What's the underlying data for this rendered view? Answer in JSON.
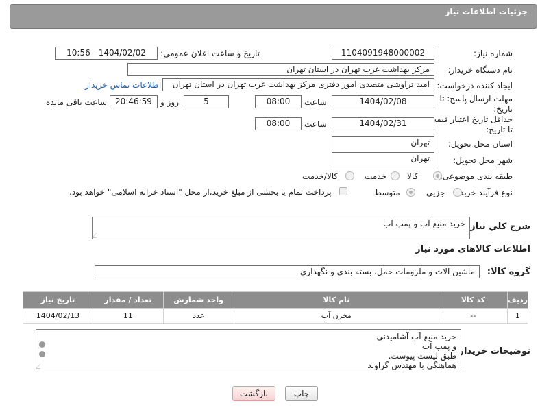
{
  "header": {
    "title": "جزئیات اطلاعات نیاز"
  },
  "fields": {
    "need_number_label": "شماره نیاز:",
    "need_number": "1104091948000002",
    "announce_label": "تاریخ و ساعت اعلان عمومی:",
    "announce_value": "1404/02/02 - 10:56",
    "buyer_org_label": "نام دستگاه خریدار:",
    "buyer_org": "مرکز بهداشت غرب تهران در استان تهران",
    "creator_label": "ایجاد کننده درخواست:",
    "creator": "امید تراوشی متصدی امور دفتری مرکز بهداشت غرب تهران در استان تهران",
    "contact_link": "اطلاعات تماس خریدار",
    "deadline_label": "مهلت ارسال پاسخ: تا تاریخ:",
    "deadline_date": "1404/02/08",
    "time_label": "ساعت",
    "deadline_time": "08:00",
    "days_value": "5",
    "days_label": "روز و",
    "remaining_time": "20:46:59",
    "remaining_label": "ساعت باقی مانده",
    "price_validity_label": "حداقل تاریخ اعتبار قیمت: تا تاریخ:",
    "price_validity_date": "1404/02/31",
    "price_validity_time": "08:00",
    "province_label": "استان محل تحویل:",
    "province": "تهران",
    "city_label": "شهر محل تحویل:",
    "city": "تهران",
    "category_label": "طبقه بندی موضوعی:",
    "category_options": [
      "کالا",
      "خدمت",
      "کالا/خدمت"
    ],
    "purchase_type_label": "نوع فرآیند خرید :",
    "purchase_options": [
      "جزیی",
      "متوسط"
    ],
    "payment_note": "پرداخت تمام یا بخشی از مبلغ خرید،از محل \"اسناد خزانه اسلامی\" خواهد بود."
  },
  "summary": {
    "label": "شرح کلي نياز:",
    "value": "خرید منبع آب و پمپ آب"
  },
  "goods": {
    "section_title": "اطلاعات کالاهای مورد نیاز",
    "group_label": "گروه کالا:",
    "group_value": "ماشین آلات و ملزومات حمل، بسته بندی و نگهداری",
    "columns": [
      "ردیف",
      "کد کالا",
      "نام کالا",
      "واحد شمارش",
      "تعداد / مقدار",
      "تاریخ نیاز"
    ],
    "rows": [
      {
        "row": "1",
        "code": "--",
        "name": "مخزن آب",
        "unit": "عدد",
        "qty": "11",
        "date": "1404/02/13"
      }
    ]
  },
  "buyer_notes": {
    "label": "توضیحات خریدار:",
    "lines": [
      "خرید منبع آب آشامیدنی",
      "و پمپ آب",
      "طبق لیست پیوست.",
      "هماهنگی با مهندس گراوند"
    ]
  },
  "buttons": {
    "print": "چاپ",
    "back": "بازگشت"
  }
}
